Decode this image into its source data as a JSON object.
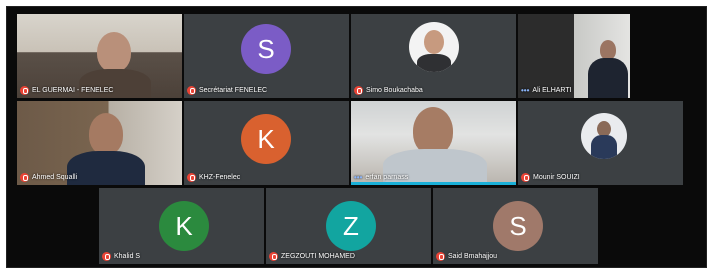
{
  "participants": [
    {
      "name": "EL GUERMAI - FENELEC",
      "muted": true
    },
    {
      "name": "Secrétariat FENELEC",
      "initial": "S",
      "color": "#7b5cc6",
      "muted": true
    },
    {
      "name": "Simo Boukachaba",
      "muted": true
    },
    {
      "name": "Ali ELHARTI",
      "muted": false,
      "speaking_dots": "•••"
    },
    {
      "name": "Ahmed Squalli",
      "muted": true
    },
    {
      "name": "KHZ-Fenelec",
      "initial": "K",
      "color": "#d9612f",
      "muted": true
    },
    {
      "name": "erfan parnass",
      "muted": false,
      "speaking_dots": "•••"
    },
    {
      "name": "Mounir SOUIZI",
      "muted": true
    },
    {
      "name": "Khalid S",
      "initial": "K",
      "color": "#2b8a3e",
      "muted": true
    },
    {
      "name": "ZEGZOUTI MOHAMED",
      "initial": "Z",
      "color": "#12a5a0",
      "muted": true
    },
    {
      "name": "Said Bmahajjou",
      "initial": "S",
      "color": "#a0796a",
      "muted": true
    }
  ],
  "colors": {
    "background": "#0a0a0a",
    "tile": "#3c4043",
    "muted_icon": "#ea4335",
    "active_bar": "#1ab0d8"
  },
  "icons": {
    "muted": "mic-off-icon",
    "speaking": "audio-dots-icon"
  }
}
